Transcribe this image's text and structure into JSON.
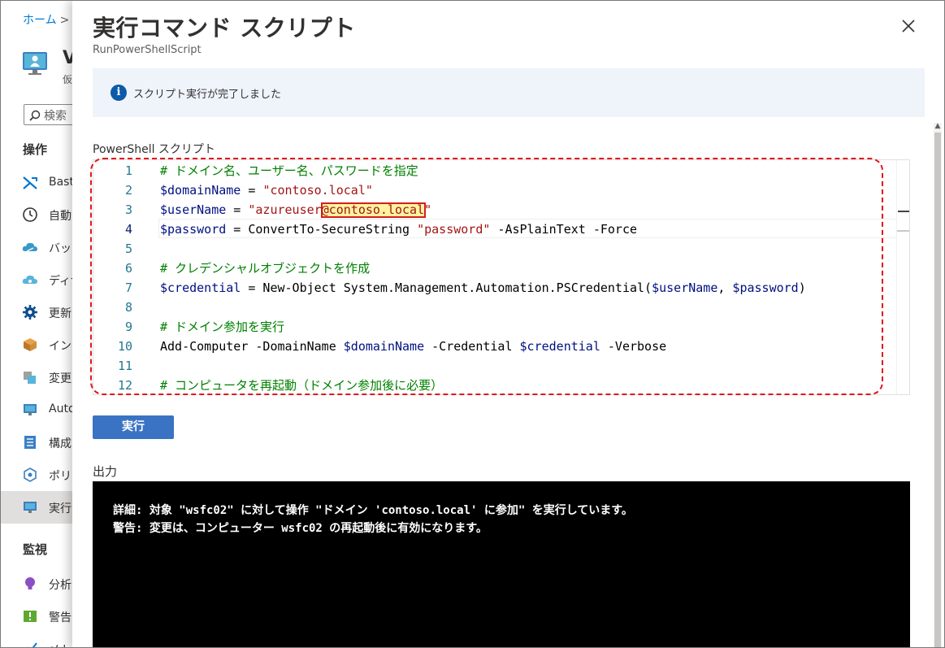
{
  "background_blade": {
    "breadcrumb_home": "ホーム",
    "breadcrumb_sep": ">",
    "vm_title_partial": "V",
    "vm_subtitle_partial": "仮",
    "search_placeholder": "検索",
    "section_operations": "操作",
    "section_monitoring": "監視",
    "items": [
      {
        "label": "Bast",
        "icon": "bastion-icon"
      },
      {
        "label": "自動",
        "icon": "clock-icon"
      },
      {
        "label": "バック",
        "icon": "backup-cloud-icon"
      },
      {
        "label": "ディザ",
        "icon": "disaster-recovery-icon"
      },
      {
        "label": "更新",
        "icon": "gear-icon"
      },
      {
        "label": "インベ",
        "icon": "inventory-box-icon"
      },
      {
        "label": "変更",
        "icon": "change-tracking-icon"
      },
      {
        "label": "Auto",
        "icon": "automanage-icon"
      },
      {
        "label": "構成",
        "icon": "configuration-icon"
      },
      {
        "label": "ポリシ",
        "icon": "policy-icon"
      },
      {
        "label": "実行",
        "icon": "run-command-icon"
      }
    ],
    "monitor_items": [
      {
        "label": "分析",
        "icon": "insights-bulb-icon"
      },
      {
        "label": "警告",
        "icon": "alerts-icon"
      },
      {
        "label": "メト",
        "icon": "metrics-icon"
      }
    ]
  },
  "panel": {
    "title": "実行コマンド スクリプト",
    "subtitle": "RunPowerShellScript",
    "info_message": "スクリプト実行が完了しました",
    "info_icon_glyph": "i",
    "editor_label": "PowerShell スクリプト",
    "run_button": "実行",
    "output_label": "出力"
  },
  "script_lines": [
    {
      "num": "1",
      "tokens": [
        {
          "t": "# ドメイン名、ユーザー名、パスワードを指定",
          "c": "com"
        }
      ]
    },
    {
      "num": "2",
      "tokens": [
        {
          "t": "$domainName",
          "c": "var"
        },
        {
          "t": " = ",
          "c": "plain"
        },
        {
          "t": "\"contoso.local\"",
          "c": "str"
        }
      ]
    },
    {
      "num": "3",
      "tokens": [
        {
          "t": "$userName",
          "c": "var"
        },
        {
          "t": " = ",
          "c": "plain"
        },
        {
          "t": "\"azureuser",
          "c": "str"
        },
        {
          "t": "@contoso.local",
          "c": "str"
        },
        {
          "t": "\"",
          "c": "str"
        }
      ]
    },
    {
      "num": "4",
      "tokens": [
        {
          "t": "$password",
          "c": "var"
        },
        {
          "t": " = ConvertTo-SecureString ",
          "c": "plain"
        },
        {
          "t": "\"password\"",
          "c": "str"
        },
        {
          "t": " -AsPlainText -Force",
          "c": "plain"
        }
      ]
    },
    {
      "num": "5",
      "tokens": []
    },
    {
      "num": "6",
      "tokens": [
        {
          "t": "# クレデンシャルオブジェクトを作成",
          "c": "com"
        }
      ]
    },
    {
      "num": "7",
      "tokens": [
        {
          "t": "$credential",
          "c": "var"
        },
        {
          "t": " = New-Object System.Management.Automation.PSCredential(",
          "c": "plain"
        },
        {
          "t": "$userName",
          "c": "var"
        },
        {
          "t": ", ",
          "c": "plain"
        },
        {
          "t": "$password",
          "c": "var"
        },
        {
          "t": ")",
          "c": "plain"
        }
      ]
    },
    {
      "num": "8",
      "tokens": []
    },
    {
      "num": "9",
      "tokens": [
        {
          "t": "# ドメイン参加を実行",
          "c": "com"
        }
      ]
    },
    {
      "num": "10",
      "tokens": [
        {
          "t": "Add-Computer -DomainName ",
          "c": "plain"
        },
        {
          "t": "$domainName",
          "c": "var"
        },
        {
          "t": " -Credential ",
          "c": "plain"
        },
        {
          "t": "$credential",
          "c": "var"
        },
        {
          "t": " -Verbose",
          "c": "plain"
        }
      ]
    },
    {
      "num": "11",
      "tokens": []
    },
    {
      "num": "12",
      "tokens": [
        {
          "t": "# コンピュータを再起動（ドメイン参加後に必要）",
          "c": "com"
        }
      ]
    }
  ],
  "output_lines": [
    "詳細: 対象 \"wsfc02\" に対して操作 \"ドメイン 'contoso.local' に参加\" を実行しています。",
    "警告: 変更は、コンピューター wsfc02 の再起動後に有効になります。"
  ],
  "colors": {
    "accent_blue": "#0078d4",
    "run_button_bg": "#3a73c4",
    "highlight_red": "#e0161c",
    "highlight_yellow": "#fff3a0",
    "comment_green": "#008000",
    "string_red": "#a31515",
    "variable_navy": "#001080"
  }
}
